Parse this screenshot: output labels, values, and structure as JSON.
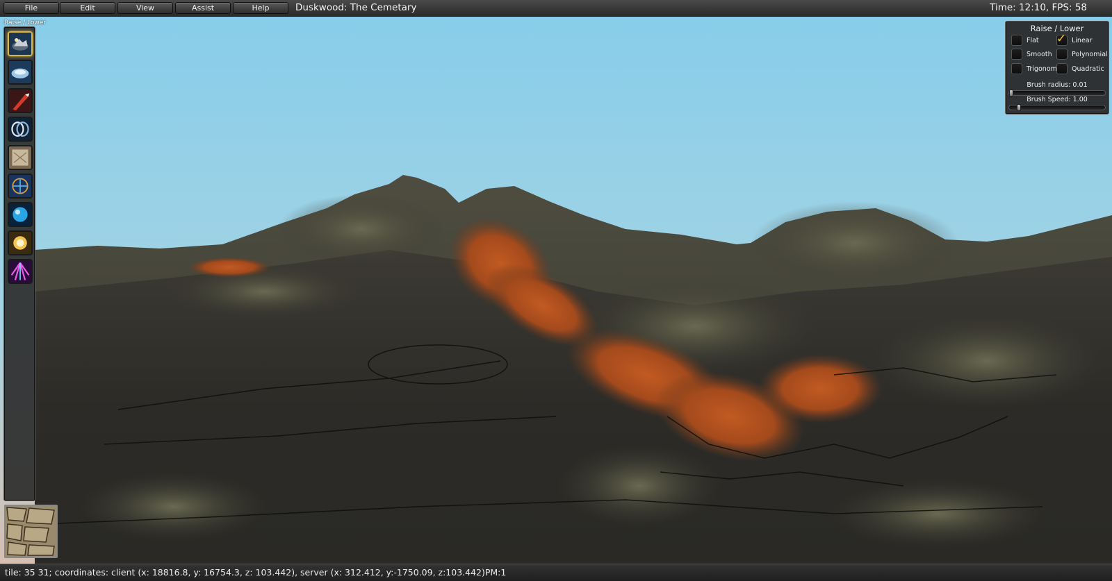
{
  "menu": {
    "file": "File",
    "edit": "Edit",
    "view": "View",
    "assist": "Assist",
    "help": "Help"
  },
  "zone_title": "Duskwood: The Cemetary",
  "clock": "Time: 12:10, FPS: 58",
  "tool_palette": {
    "caption": "Raise / Lower",
    "tools": [
      {
        "icon": "raise-lower-icon",
        "active": true
      },
      {
        "icon": "flatten-icon",
        "active": false
      },
      {
        "icon": "paint-brush-icon",
        "active": false
      },
      {
        "icon": "rings-icon",
        "active": false
      },
      {
        "icon": "parchment-icon",
        "active": false
      },
      {
        "icon": "pattern-icon",
        "active": false
      },
      {
        "icon": "water-orb-icon",
        "active": false
      },
      {
        "icon": "light-burst-icon",
        "active": false
      },
      {
        "icon": "crystal-icon",
        "active": false
      }
    ],
    "texture_swatch_icon": "cracked-ground-texture"
  },
  "brush_panel": {
    "title": "Raise / Lower",
    "options": [
      {
        "label": "Flat",
        "checked": false
      },
      {
        "label": "Linear",
        "checked": true
      },
      {
        "label": "Smooth",
        "checked": false
      },
      {
        "label": "Polynomial",
        "checked": false
      },
      {
        "label": "Trigonom",
        "checked": false
      },
      {
        "label": "Quadratic",
        "checked": false
      }
    ],
    "radius_label": "Brush radius: 0.01",
    "radius_value": 0.0,
    "speed_label": "Brush Speed: 1.00",
    "speed_value": 0.08
  },
  "status": "tile: 35 31; coordinates: client (x: 18816.8, y: 16754.3, z: 103.442), server (x: 312.412, y:-1750.09, z:103.442)PM:1",
  "colors": {
    "accent_gold": "#d9b648",
    "check_yellow": "#f0c830",
    "sky_top": "#86cdea",
    "terrain_rust": "#b4521e"
  }
}
